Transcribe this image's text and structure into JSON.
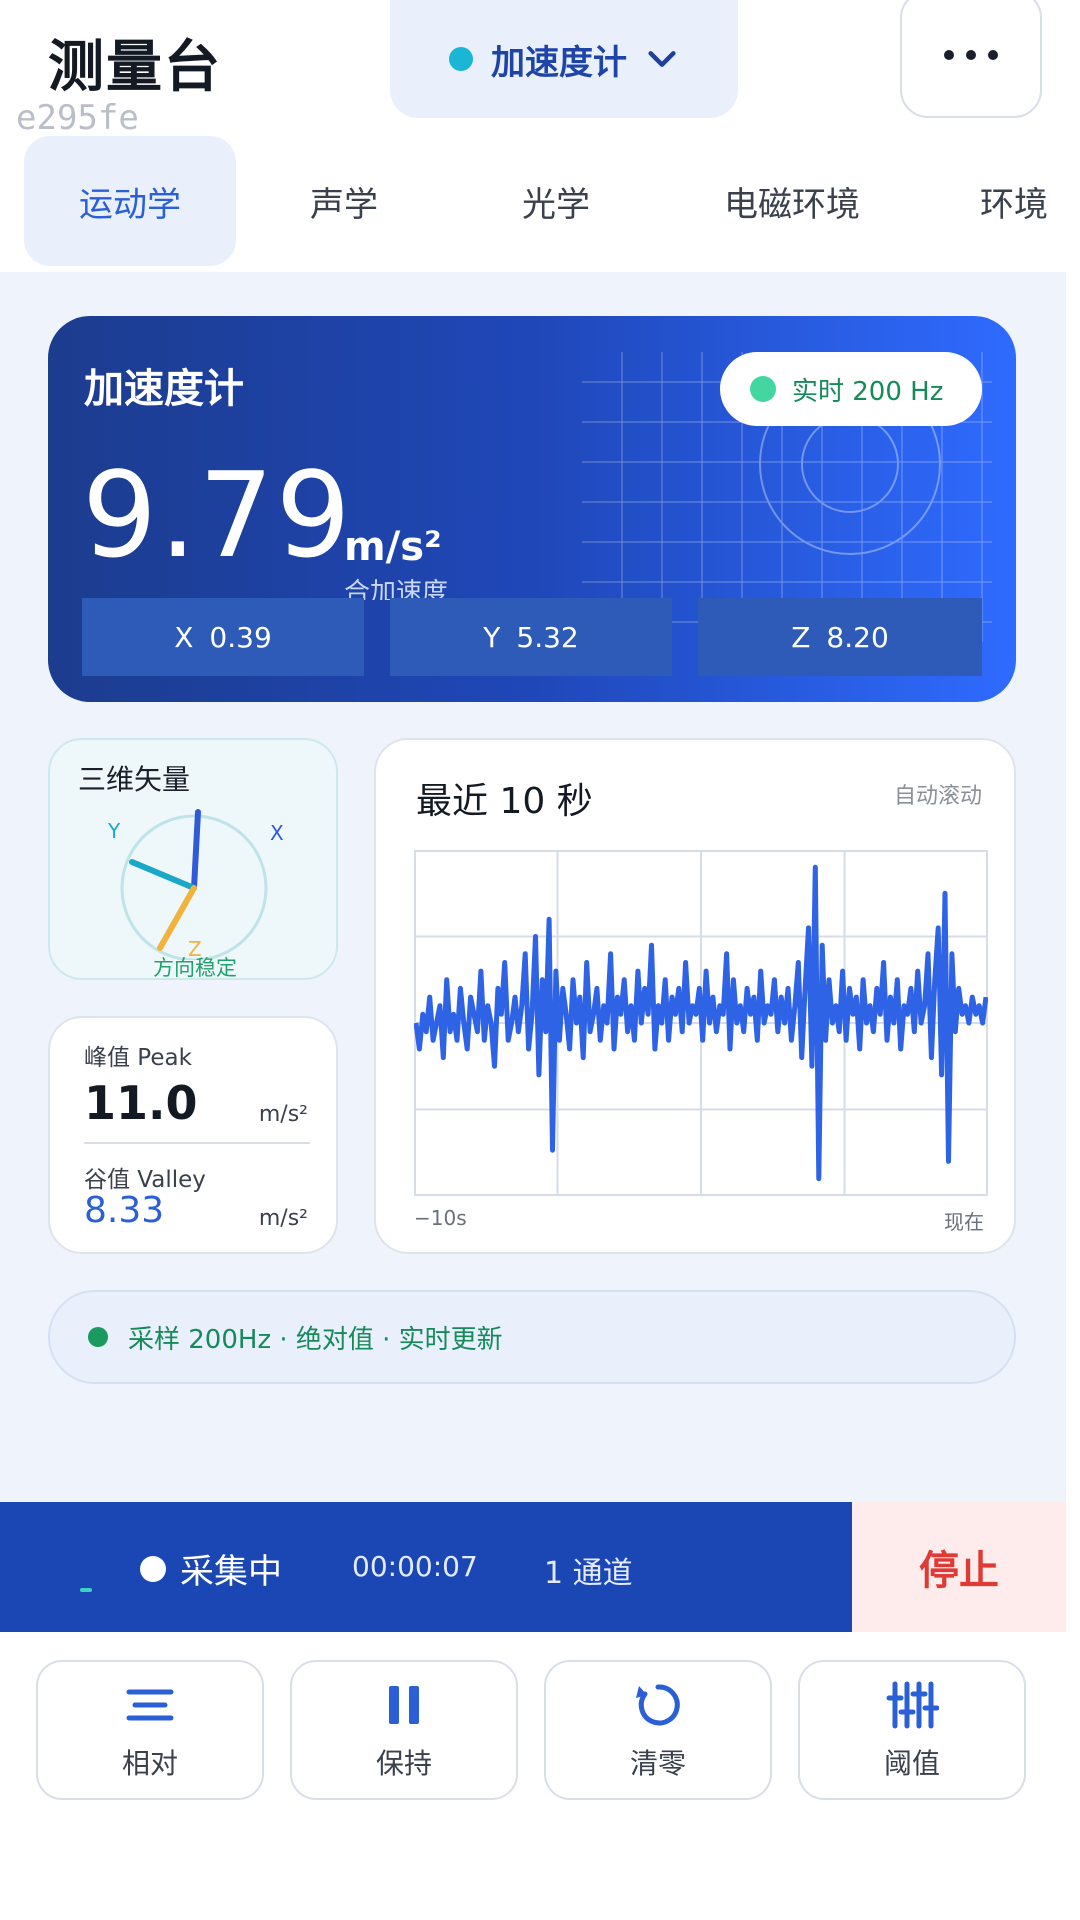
{
  "header": {
    "app_title": "测量台",
    "build_id": "e295fe",
    "sensor_select": {
      "label": "加速度计",
      "dot_color": "#1bb6d6",
      "icon": "chevron-down-icon"
    },
    "menu_icon": "more-icon"
  },
  "tabs": [
    {
      "label": "运动学",
      "active": true
    },
    {
      "label": "声学",
      "active": false
    },
    {
      "label": "光学",
      "active": false
    },
    {
      "label": "电磁环境",
      "active": false
    },
    {
      "label": "环境",
      "active": false
    }
  ],
  "hero": {
    "title": "加速度计",
    "live_badge": "实时 200 Hz",
    "value": "9.79",
    "unit": "m/s²",
    "caption": "合加速度",
    "axes": [
      {
        "axis": "X",
        "value": "0.39"
      },
      {
        "axis": "Y",
        "value": "5.32"
      },
      {
        "axis": "Z",
        "value": "8.20"
      }
    ]
  },
  "vector": {
    "title": "三维矢量",
    "x_label": "X",
    "y_label": "Y",
    "z_label": "Z",
    "status": "方向稳定"
  },
  "extremes": {
    "peak_label": "峰值 Peak",
    "peak_value": "11.0",
    "peak_unit": "m/s²",
    "valley_label": "谷值 Valley",
    "valley_value": "8.33",
    "valley_unit": "m/s²"
  },
  "chart_data": {
    "type": "line",
    "title": "最近 10 秒",
    "note": "自动滚动",
    "x_start_label": "−10s",
    "x_end_label": "现在",
    "color": "#2f63e6",
    "series": [
      {
        "values": [
          9.8,
          9.5,
          9.9,
          9.7,
          10.1,
          9.6,
          9.8,
          10.0,
          9.4,
          10.3,
          9.7,
          9.9,
          9.6,
          10.2,
          9.8,
          9.5,
          10.1,
          9.9,
          9.7,
          10.4,
          9.6,
          10.0,
          9.8,
          9.3,
          10.2,
          9.9,
          10.5,
          9.6,
          9.8,
          10.1,
          9.7,
          10.0,
          10.6,
          9.5,
          9.9,
          10.8,
          9.2,
          10.3,
          9.7,
          11.0,
          8.33,
          10.4,
          9.6,
          10.2,
          9.9,
          9.5,
          10.3,
          9.8,
          10.1,
          9.4,
          10.5,
          9.7,
          9.9,
          10.2,
          9.6,
          10.0,
          9.8,
          10.6,
          9.5,
          10.1,
          9.9,
          10.3,
          9.7,
          10.0,
          9.6,
          10.4,
          9.8,
          10.2,
          9.9,
          10.7,
          9.5,
          10.0,
          9.8,
          10.3,
          9.6,
          10.1,
          9.9,
          10.2,
          9.7,
          10.5,
          9.8,
          10.0,
          9.9,
          10.2,
          9.6,
          10.4,
          9.8,
          10.1,
          9.7,
          10.0,
          9.9,
          10.6,
          9.5,
          10.3,
          9.8,
          10.0,
          9.7,
          10.2,
          9.9,
          10.1,
          9.6,
          10.4,
          9.8,
          10.0,
          9.9,
          10.3,
          9.7,
          10.1,
          9.8,
          10.2,
          9.6,
          10.0,
          10.5,
          9.4,
          10.2,
          10.9,
          9.3,
          11.6,
          8.0,
          10.7,
          9.6,
          10.3,
          9.8,
          10.0,
          9.7,
          10.4,
          9.6,
          10.2,
          9.9,
          10.1,
          9.5,
          10.3,
          9.8,
          10.0,
          9.7,
          10.2,
          9.9,
          10.5,
          9.6,
          10.1,
          9.8,
          10.3,
          9.5,
          10.0,
          9.9,
          10.2,
          9.7,
          10.4,
          9.8,
          10.0,
          10.6,
          9.4,
          10.3,
          10.9,
          9.2,
          11.3,
          8.2,
          10.6,
          9.7,
          10.2,
          9.9,
          10.0,
          9.8,
          10.1,
          9.9,
          10.0,
          9.8,
          10.1
        ]
      }
    ],
    "ylim": [
      7.8,
      11.8
    ]
  },
  "info_bar": {
    "text": "采样 200Hz · 绝对值 · 实时更新"
  },
  "recording": {
    "state": "采集中",
    "elapsed": "00:00:07",
    "channels": "1 通道",
    "stop_label": "停止"
  },
  "actions": [
    {
      "label": "相对",
      "icon": "relative-lines-icon"
    },
    {
      "label": "保持",
      "icon": "pause-icon"
    },
    {
      "label": "清零",
      "icon": "reset-icon"
    },
    {
      "label": "阈值",
      "icon": "sliders-icon"
    }
  ]
}
